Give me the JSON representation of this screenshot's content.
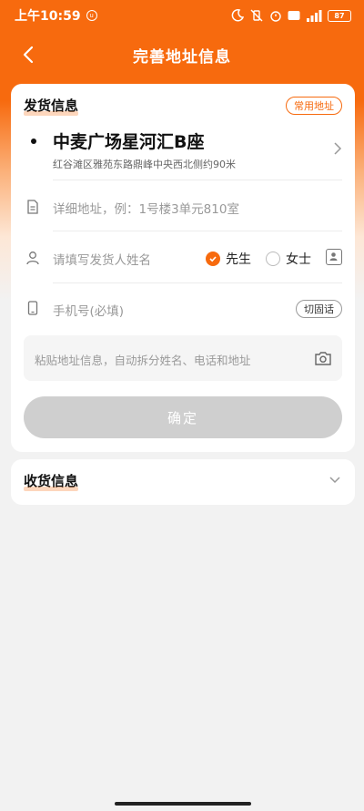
{
  "status_bar": {
    "time": "上午10:59",
    "battery": "87"
  },
  "nav": {
    "title": "完善地址信息"
  },
  "sender": {
    "section_title": "发货信息",
    "common_address_label": "常用地址",
    "address_main": "中麦广场星河汇B座",
    "address_sub": "红谷滩区雅苑东路鼎峰中央西北侧约90米",
    "detail_placeholder": "详细地址，例：1号楼3单元810室",
    "name_placeholder": "请填写发货人姓名",
    "gender_male": "先生",
    "gender_female": "女士",
    "selected_gender": "先生",
    "phone_placeholder": "手机号(必填)",
    "switch_phone_label": "切固话",
    "paste_placeholder": "粘贴地址信息，自动拆分姓名、电话和地址",
    "confirm_label": "确定"
  },
  "receiver": {
    "section_title": "收货信息"
  },
  "colors": {
    "accent": "#f76a0e",
    "disabled": "#cfcfcf"
  }
}
